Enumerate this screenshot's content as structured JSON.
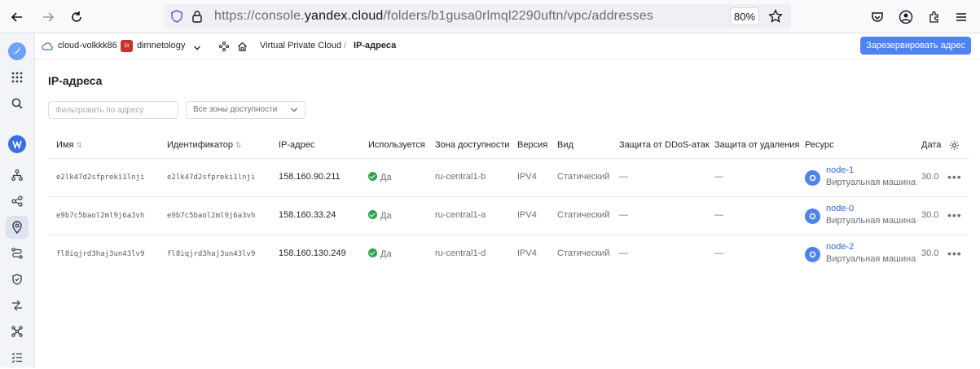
{
  "browser": {
    "url_prefix": "https://console.",
    "url_host": "yandex.cloud",
    "url_path": "/folders/b1gusa0rlmql2290uftn/vpc/addresses",
    "zoom": "80%"
  },
  "header": {
    "cloud": "cloud-volkkk86",
    "folder_badge": "DI",
    "folder": "dimnetology",
    "breadcrumb_service": "Virtual Private Cloud",
    "breadcrumb_sep": "/",
    "breadcrumb_current": "IP-адреса",
    "reserve_button": "Зарезервировать адрес"
  },
  "page": {
    "title": "IP-адреса",
    "filter_placeholder": "Фильтровать по адресу",
    "zone_select": "Все зоны доступности"
  },
  "table": {
    "columns": [
      "Имя",
      "Идентификатор",
      "IP-адрес",
      "Используется",
      "Зона доступности",
      "Версия",
      "Вид",
      "Защита от DDoS-атак",
      "Защита от удаления",
      "Ресурс",
      "Дата"
    ],
    "rows": [
      {
        "name": "e2lk47d2sfpreki1lnji",
        "id": "e2lk47d2sfpreki1lnji",
        "ip": "158.160.90.211",
        "used": "Да",
        "zone": "ru-central1-b",
        "version": "IPV4",
        "kind": "Статический",
        "ddos": "—",
        "deletion": "—",
        "resource_name": "node-1",
        "resource_type": "Виртуальная машина",
        "date": "30.0"
      },
      {
        "name": "e9b7c5baol2ml9j6a3vh",
        "id": "e9b7c5baol2ml9j6a3vh",
        "ip": "158.160.33.24",
        "used": "Да",
        "zone": "ru-central1-a",
        "version": "IPV4",
        "kind": "Статический",
        "ddos": "—",
        "deletion": "—",
        "resource_name": "node-0",
        "resource_type": "Виртуальная машина",
        "date": "30.0"
      },
      {
        "name": "fl8iqjrd3haj3un43lv9",
        "id": "fl8iqjrd3haj3un43lv9",
        "ip": "158.160.130.249",
        "used": "Да",
        "zone": "ru-central1-d",
        "version": "IPV4",
        "kind": "Статический",
        "ddos": "—",
        "deletion": "—",
        "resource_name": "node-2",
        "resource_type": "Виртуальная машина",
        "date": "30.0"
      }
    ]
  },
  "colors": {
    "accent": "#4f83f1",
    "success": "#2ea44f",
    "link": "#2f66d9"
  }
}
